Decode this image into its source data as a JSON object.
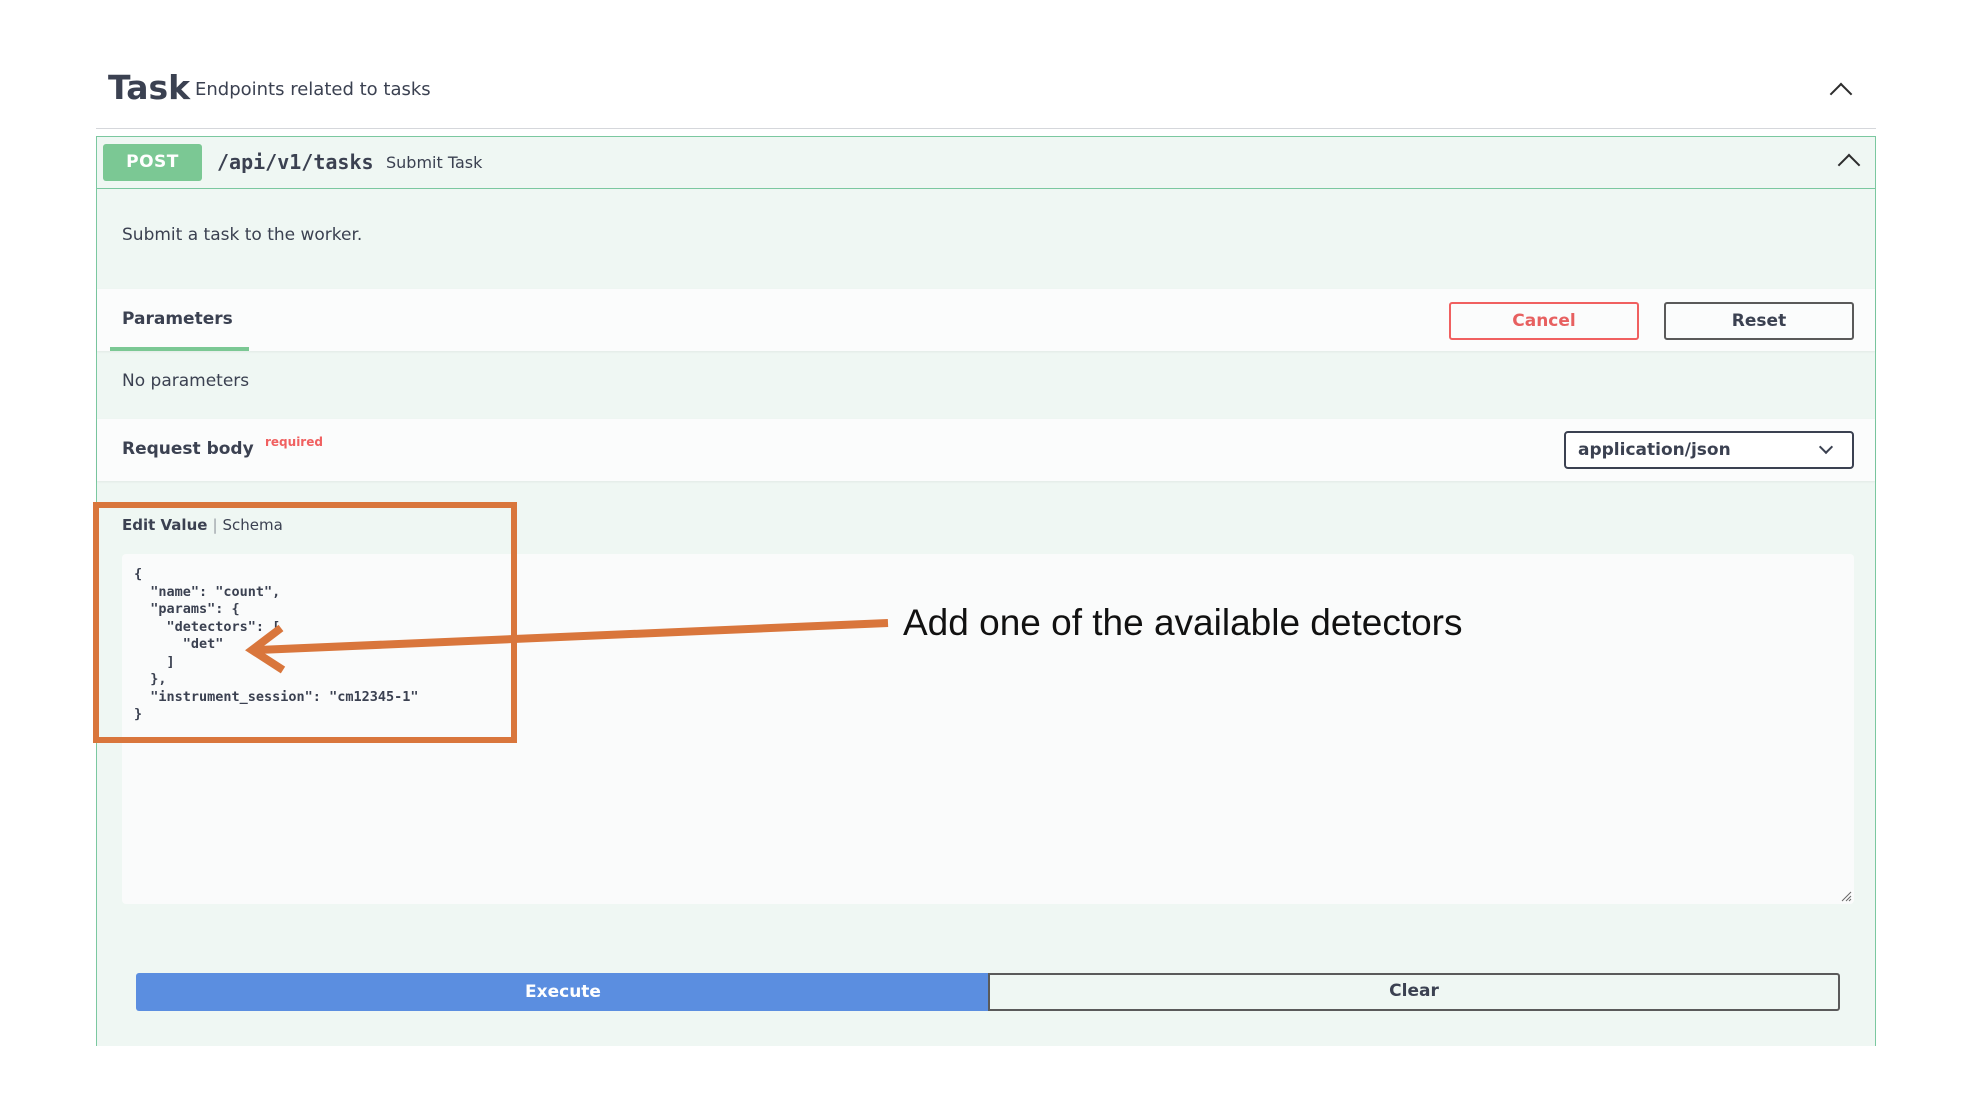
{
  "tag": {
    "name": "Task",
    "description": "Endpoints related to tasks"
  },
  "operation": {
    "method": "POST",
    "path": "/api/v1/tasks",
    "summary": "Submit Task",
    "description": "Submit a task to the worker.",
    "parameters_tab": "Parameters",
    "cancel_label": "Cancel",
    "reset_label": "Reset",
    "no_parameters": "No parameters",
    "request_body_label": "Request body",
    "required_label": "required",
    "content_type": "application/json",
    "edit_value_tab": "Edit Value",
    "schema_tab": "Schema",
    "body_value": "{\n  \"name\": \"count\",\n  \"params\": {\n    \"detectors\": [\n      \"det\"\n    ]\n  },\n  \"instrument_session\": \"cm12345-1\"\n}",
    "execute_label": "Execute",
    "clear_label": "Clear"
  },
  "annotation": {
    "text": "Add one of the available detectors"
  },
  "colors": {
    "post_green": "#7bc894",
    "execute_blue": "#5b8ee0",
    "cancel_red": "#f06060",
    "annotation_orange": "#d9763c"
  },
  "icons": [
    "chevron-up-icon",
    "chevron-down-icon",
    "resize-grip-icon",
    "arrow-icon"
  ]
}
